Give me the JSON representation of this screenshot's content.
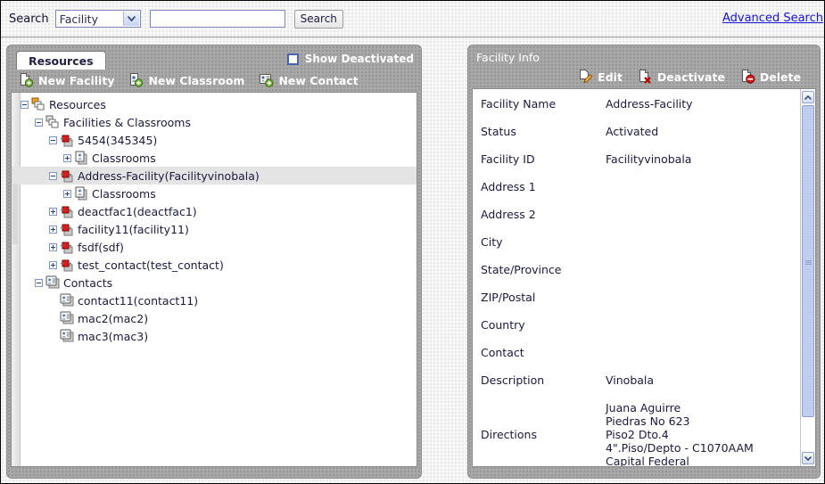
{
  "search": {
    "label": "Search",
    "type_selected": "Facility",
    "query_value": "",
    "query_placeholder": "",
    "button_label": "Search",
    "advanced_link": "Advanced Search"
  },
  "left_panel": {
    "tab_label": "Resources",
    "show_deactivated_label": "Show Deactivated",
    "show_deactivated_checked": false,
    "toolbar": [
      {
        "label": "New Facility",
        "icon": "new-facility-icon"
      },
      {
        "label": "New Classroom",
        "icon": "new-classroom-icon"
      },
      {
        "label": "New Contact",
        "icon": "new-contact-icon"
      }
    ],
    "tree": [
      {
        "label": "Resources",
        "indent": 0,
        "toggle": "minus",
        "icon": "resources-node-icon",
        "selected": false
      },
      {
        "label": "Facilities & Classrooms",
        "indent": 1,
        "toggle": "minus",
        "icon": "folder-node-icon",
        "selected": false
      },
      {
        "label": "5454(345345)",
        "indent": 2,
        "toggle": "minus",
        "icon": "facility-icon",
        "selected": false
      },
      {
        "label": "Classrooms",
        "indent": 3,
        "toggle": "plus",
        "icon": "classrooms-icon",
        "selected": false
      },
      {
        "label": "Address-Facility(Facilityvinobala)",
        "indent": 2,
        "toggle": "minus",
        "icon": "facility-icon",
        "selected": true
      },
      {
        "label": "Classrooms",
        "indent": 3,
        "toggle": "plus",
        "icon": "classrooms-icon",
        "selected": false
      },
      {
        "label": "deactfac1(deactfac1)",
        "indent": 2,
        "toggle": "plus",
        "icon": "facility-icon",
        "selected": false
      },
      {
        "label": "facility11(facility11)",
        "indent": 2,
        "toggle": "plus",
        "icon": "facility-icon",
        "selected": false
      },
      {
        "label": "fsdf(sdf)",
        "indent": 2,
        "toggle": "plus",
        "icon": "facility-icon",
        "selected": false
      },
      {
        "label": "test_contact(test_contact)",
        "indent": 2,
        "toggle": "plus",
        "icon": "facility-icon",
        "selected": false
      },
      {
        "label": "Contacts",
        "indent": 1,
        "toggle": "minus",
        "icon": "contacts-folder-icon",
        "selected": false
      },
      {
        "label": "contact11(contact11)",
        "indent": 2,
        "toggle": "none",
        "icon": "contact-icon",
        "selected": false
      },
      {
        "label": "mac2(mac2)",
        "indent": 2,
        "toggle": "none",
        "icon": "contact-icon",
        "selected": false
      },
      {
        "label": "mac3(mac3)",
        "indent": 2,
        "toggle": "none",
        "icon": "contact-icon",
        "selected": false
      }
    ]
  },
  "right_panel": {
    "title": "Facility Info",
    "actions": [
      {
        "label": "Edit",
        "icon": "edit-pencil-icon"
      },
      {
        "label": "Deactivate",
        "icon": "deactivate-icon"
      },
      {
        "label": "Delete",
        "icon": "delete-icon"
      }
    ],
    "fields": [
      {
        "label": "Facility Name",
        "value": "Address-Facility"
      },
      {
        "label": "Status",
        "value": "Activated"
      },
      {
        "label": "Facility ID",
        "value": "Facilityvinobala"
      },
      {
        "label": "Address 1",
        "value": ""
      },
      {
        "label": "Address 2",
        "value": ""
      },
      {
        "label": "City",
        "value": ""
      },
      {
        "label": "State/Province",
        "value": ""
      },
      {
        "label": "ZIP/Postal",
        "value": ""
      },
      {
        "label": "Country",
        "value": ""
      },
      {
        "label": "Contact",
        "value": ""
      },
      {
        "label": "Description",
        "value": "Vinobala"
      },
      {
        "label": "Directions",
        "value": "Juana Aguirre\nPiedras No 623\nPiso2 Dto.4\n4\".Piso/Depto - C1070AAM\nCapital Federal"
      }
    ]
  }
}
